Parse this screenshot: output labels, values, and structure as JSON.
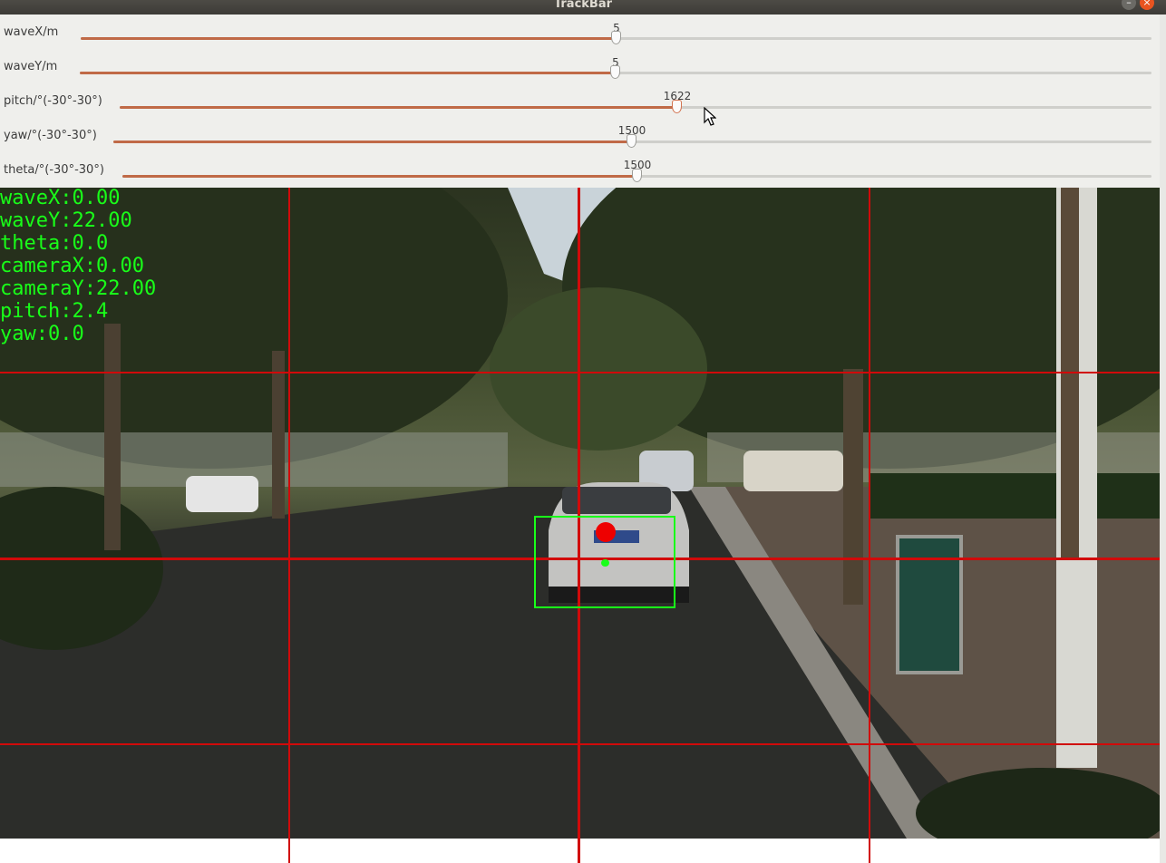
{
  "window": {
    "title": "TrackBar"
  },
  "trackbars": [
    {
      "label": "waveX/m",
      "value": "5"
    },
    {
      "label": "waveY/m",
      "value": "5"
    },
    {
      "label": "pitch/°(-30°-30°)",
      "value": "1622"
    },
    {
      "label": "yaw/°(-30°-30°)",
      "value": "1500"
    },
    {
      "label": "theta/°(-30°-30°)",
      "value": "1500"
    }
  ],
  "overlay": {
    "lines": [
      "waveX:0.00",
      "waveY:22.00",
      "theta:0.0",
      "cameraX:0.00",
      "cameraY:22.00",
      "pitch:2.4",
      "yaw:0.0"
    ]
  },
  "colors": {
    "overlay_text": "#19ff19",
    "grid_line": "#d10a0a",
    "bbox": "#19ff19",
    "slider_fill": "#c06a47"
  },
  "detection": {
    "label": "car"
  }
}
